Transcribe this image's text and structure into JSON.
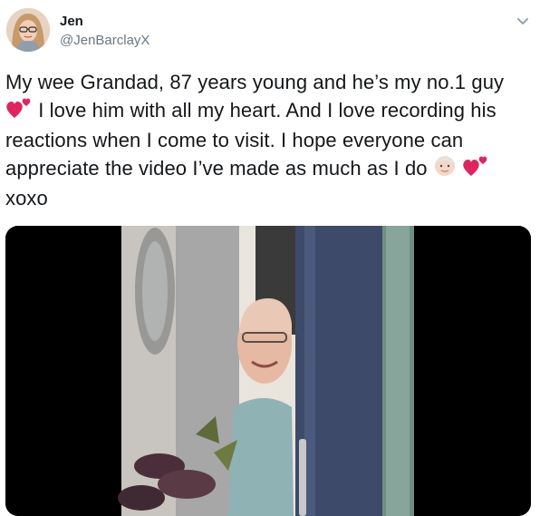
{
  "author": {
    "display_name": "Jen",
    "handle": "@JenBarclayX"
  },
  "tweet": {
    "line1": "My wee Grandad, 87 years young and he’s my no.1 guy",
    "line2": "I love him with all my heart. And I love recording his",
    "line3": "reactions when I come to visit. I hope everyone can",
    "line4": "appreciate the video I’ve made as much as I do",
    "line5": "xoxo"
  },
  "icons": {
    "menu": "chevron-down-icon",
    "heart": "two-hearts-emoji",
    "old_man": "old-man-emoji"
  },
  "colors": {
    "text": "#14171a",
    "secondary": "#657786",
    "heart": "#e0245e",
    "media_bg": "#000000"
  }
}
